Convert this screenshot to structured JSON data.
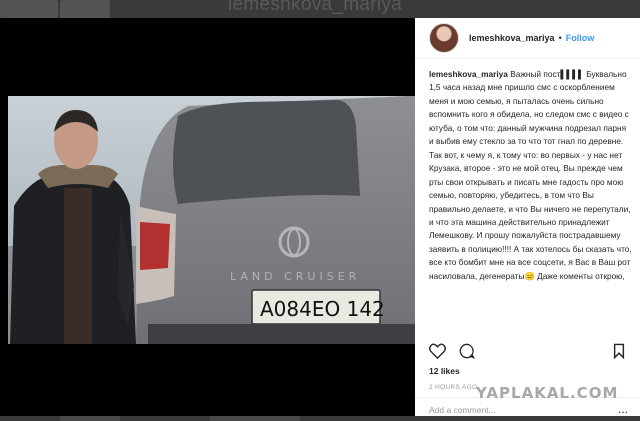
{
  "background": {
    "title": "lemeshkova_mariya"
  },
  "post": {
    "username": "lemeshkova_mariya",
    "follow_label": "Follow",
    "caption_user": "lemeshkova_mariya",
    "caption_text": "Важный пост▌▌▌▌ Буквально 1,5 часа назад мне пришло смс с оскорблением меня и мою семью, я пыталась очень сильно вспомнить кого я обидела, но следом смс с видео с ютуба, о том что: данный мужчина подрезал парня и выбив ему стекло за то что тот гнал по деревне. Так вот, к чему я, к тому что: во первых - у нас нет Крузака, второе - это не мой отец. Вы прежде чем рты свои открывать и писать мне гадость про мою семью, повторяю, убедитесь, в том что Вы правильно делаете, и что Вы ничего не перепутали, и что эта машина действительно принадлежит Лемешкову. И прошу пожалуйста пострадавшему заявить в полицию!!!! А так хотелось бы сказать что, все кто бомбит мне на все соцсети, я Вас в Ваш рот насиловала, дегенераты😑 Даже коменты открою,",
    "likes": "12 likes",
    "time": "2 HOURS AGO",
    "comment_placeholder": "Add a comment...",
    "more": "..."
  },
  "photo": {
    "license_plate": "А084ЕО 142",
    "car_badge": "LAND CRUISER"
  },
  "watermark": "YAPLAKAL.COM",
  "icons": [
    "heart-icon",
    "comment-icon",
    "bookmark-icon",
    "toyota-logo-icon"
  ],
  "colors": {
    "follow": "#3897f0",
    "text": "#262626",
    "muted": "#999999"
  }
}
